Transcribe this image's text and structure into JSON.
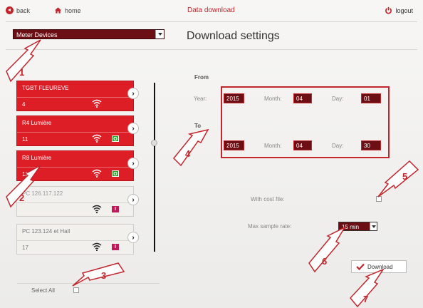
{
  "topbar": {
    "back_label": "back",
    "home_label": "home",
    "title": "Data download",
    "logout_label": "logout"
  },
  "device_selector": {
    "value": "Meter Devices"
  },
  "panel_title": "Download settings",
  "devices": [
    {
      "name": "TGBT FLEUREVE",
      "number": "4",
      "status": ""
    },
    {
      "name": "R4 Lumière",
      "number": "11",
      "status": "O"
    },
    {
      "name": "R8 Lumière",
      "number": "12",
      "status": "O"
    },
    {
      "name": "PC 126.117.122",
      "number": "",
      "status": "I"
    },
    {
      "name": "PC 123.124 et Hall",
      "number": "17",
      "status": "I"
    }
  ],
  "select_all_label": "Select All",
  "from": {
    "heading": "From",
    "year_label": "Year:",
    "year": "2015",
    "month_label": "Month:",
    "month": "04",
    "day_label": "Day:",
    "day": "01"
  },
  "to": {
    "heading": "To",
    "year_label": "Year:",
    "year": "2015",
    "month_label": "Month:",
    "month": "04",
    "day_label": "Day:",
    "day": "30"
  },
  "cost_file_label": "With cost file:",
  "max_rate": {
    "label": "Max sample rate:",
    "value": "15 min"
  },
  "download_label": "Download",
  "callouts": [
    "1",
    "2",
    "3",
    "4",
    "5",
    "6",
    "7"
  ],
  "colors": {
    "accent": "#c0262c",
    "field": "#6b0f14",
    "card": "#de1e26",
    "ok": "#2aa332",
    "bad": "#c2185b"
  }
}
